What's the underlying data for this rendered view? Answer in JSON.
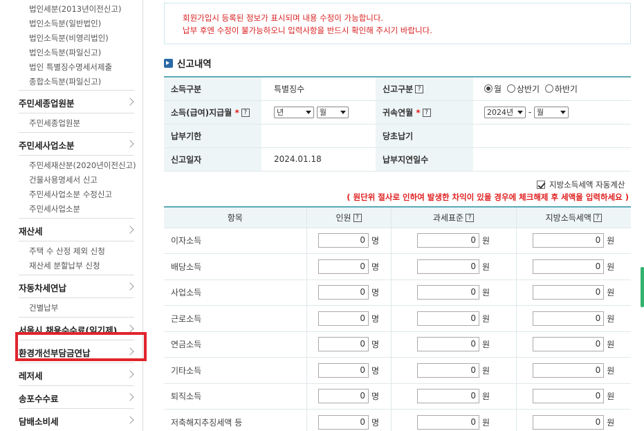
{
  "sidebar": {
    "top_subs": [
      "법인세분(2013년이전신고)",
      "법인소득분(일반법인)",
      "법인소득분(비영리법인)",
      "법인소득분(파일신고)",
      "법인 특별징수명세서제출",
      "종합소득분(파일신고)"
    ],
    "groups": [
      {
        "label": "주민세종업원분",
        "subs": [
          "주민세종업원분"
        ]
      },
      {
        "label": "주민세사업소분",
        "subs": [
          "주민세재산분(2020년이전신고)",
          "건물사용명세서 신고",
          "주민세사업소분 수정신고",
          "주민세사업소분"
        ]
      },
      {
        "label": "재산세",
        "subs": [
          "주택 수 산정 제외 신청",
          "재산세 분할납부 신청"
        ]
      },
      {
        "label": "자동차세연납",
        "subs": [
          "건별납부"
        ]
      },
      {
        "label": "서울시 채용수수료(임기제)",
        "subs": []
      },
      {
        "label": "환경개선부담금연납",
        "subs": []
      },
      {
        "label": "레저세",
        "subs": []
      },
      {
        "label": "송포수수료",
        "subs": []
      },
      {
        "label": "담배소비세",
        "subs": []
      }
    ]
  },
  "notice": {
    "line1": "회원가입시 등록된 정보가 표시되며 내용 수정이 가능합니다.",
    "line2": "납부 후엔 수정이 불가능하오니 입력사항을 반드시 확인해 주시기 바랍니다."
  },
  "section_title": "신고내역",
  "info": {
    "income_type_label": "소득구분",
    "income_type_value": "특별징수",
    "report_type_label": "신고구분",
    "radio_monthly": "월",
    "radio_first_half": "상반기",
    "radio_second_half": "하반기",
    "pay_month_label": "소득(급여)지급월",
    "required_mark": "*",
    "help_mark": "?",
    "year_select": "년",
    "month_select": "월",
    "attrib_label": "귀속연월",
    "attrib_year": "2024년",
    "dash": "-",
    "attrib_month": "월",
    "due_label": "납부기한",
    "due_value": "",
    "orig_due_label": "당초납기",
    "orig_due_value": "",
    "report_date_label": "신고일자",
    "report_date_value": "2024.01.18",
    "delay_label": "납부지연일수",
    "delay_value": ""
  },
  "auto_calc_label": "지방소득세액 자동계산",
  "warning": "( 원단위 절사로 인하여 발생한 차익이 있을 경우에 체크해제 후 세액을 입력하세요 )",
  "table": {
    "headers": [
      "항목",
      "인원",
      "과세표준",
      "지방소득세액"
    ],
    "units": [
      "명",
      "원",
      "원"
    ],
    "rows": [
      {
        "item": "이자소득",
        "people": "0",
        "base": "0",
        "tax": "0"
      },
      {
        "item": "배당소득",
        "people": "0",
        "base": "0",
        "tax": "0"
      },
      {
        "item": "사업소득",
        "people": "0",
        "base": "0",
        "tax": "0"
      },
      {
        "item": "근로소득",
        "people": "0",
        "base": "0",
        "tax": "0"
      },
      {
        "item": "연금소득",
        "people": "0",
        "base": "0",
        "tax": "0"
      },
      {
        "item": "기타소득",
        "people": "0",
        "base": "0",
        "tax": "0"
      },
      {
        "item": "퇴직소득",
        "people": "0",
        "base": "0",
        "tax": "0"
      },
      {
        "item": "저축해지추징세액 등",
        "people": "0",
        "base": "0",
        "tax": "0"
      }
    ]
  },
  "colors": {
    "accent": "#5aaab5",
    "highlight": "#e0242b",
    "warn": "#e02020"
  }
}
